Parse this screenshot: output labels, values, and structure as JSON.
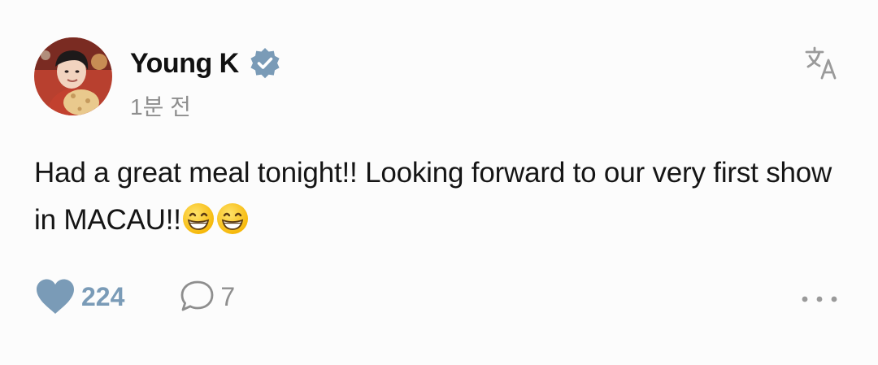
{
  "author": {
    "name": "Young K",
    "verified": true,
    "time_ago": "1분 전"
  },
  "post": {
    "text": "Had a great meal tonight!! Looking forward to our very first show in MACAU!!",
    "emojis": [
      "grinning-face-with-smiling-eyes",
      "grinning-face-with-smiling-eyes"
    ]
  },
  "actions": {
    "likes": "224",
    "comments": "7"
  },
  "icons": {
    "verified": "verified-badge-icon",
    "translate": "translate-icon",
    "like": "heart-icon",
    "comment": "comment-bubble-icon",
    "more": "more-dots-icon"
  },
  "colors": {
    "accent": "#7a9bb7",
    "muted": "#8e8e8e",
    "text": "#151515",
    "background": "#fcfcfc"
  }
}
